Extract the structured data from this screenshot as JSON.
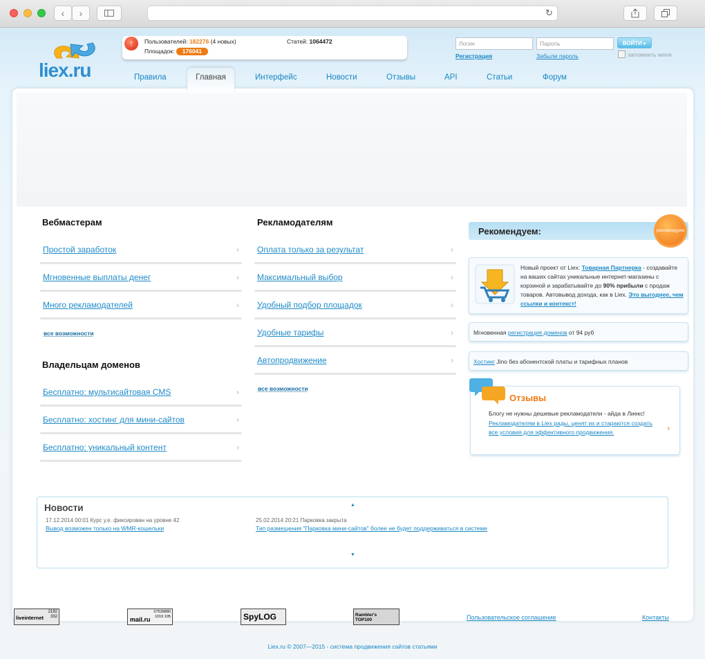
{
  "browser": {
    "back_icon": "chevron-left-icon",
    "forward_icon": "chevron-right-icon",
    "sidebar_icon": "sidebar-icon",
    "reload_icon": "reload-icon",
    "share_icon": "share-icon",
    "tabs_icon": "tabs-icon"
  },
  "header": {
    "logo_text": "liex.ru",
    "stats": {
      "users_label": "Пользователей:",
      "users_value": "182276",
      "users_new": "(4 новых)",
      "sites_label": "Площадок:",
      "sites_value": "176041",
      "articles_label": "Статей:",
      "articles_value": "1064472"
    },
    "login": {
      "login_placeholder": "Логин",
      "password_placeholder": "Пароль",
      "submit_label": "ВОЙТИ",
      "register_label": "Регистрация",
      "forgot_label": "Забыли пароль",
      "remember_label": "запомнить меня"
    }
  },
  "menu": {
    "items": [
      {
        "label": "Правила"
      },
      {
        "label": "Главная"
      },
      {
        "label": "Интерфейс"
      },
      {
        "label": "Новости"
      },
      {
        "label": "Отзывы"
      },
      {
        "label": "API"
      },
      {
        "label": "Статьи"
      },
      {
        "label": "Форум"
      }
    ]
  },
  "webmasters": {
    "title": "Вебмастерам",
    "items": [
      {
        "label": "Простой заработок"
      },
      {
        "label": "Мгновенные выплаты денег"
      },
      {
        "label": "Много рекламодателей"
      }
    ],
    "all_label": "все возможности"
  },
  "domain_owners": {
    "title": "Владельцам доменов",
    "items": [
      {
        "label": "Бесплатно: мультисайтовая CMS"
      },
      {
        "label": "Бесплатно: хостинг для мини-сайтов"
      },
      {
        "label": "Бесплатно: уникальный контент"
      }
    ]
  },
  "advertisers": {
    "title": "Рекламодателям",
    "items": [
      {
        "label": "Оплата только за результат"
      },
      {
        "label": "Максимальный выбор"
      },
      {
        "label": "Удобный подбор площадок"
      },
      {
        "label": "Удобные тарифы"
      },
      {
        "label": "Автопродвижение"
      }
    ],
    "all_label": "все возможности"
  },
  "recommend": {
    "title": "Рекомендуем:",
    "badge": "рекомендуем",
    "box1": {
      "text1": "Новый проект от Liex:",
      "link1": "Товарная Партнерка",
      "text2": "- создавайте на ваших сайтах уникальные интернет-магазины с корзиной и зарабатывайте до",
      "percent": "90% прибыли",
      "text3": "с продаж товаров. Автовывод дохода, как в Liex.",
      "link2": "Это выгоднее, чем ссылки и контекст!"
    },
    "box2": {
      "text1": "Мгновенная",
      "link": "регистрация доменов",
      "text2": "от 94 руб"
    },
    "box3": {
      "link": "Хостинг",
      "text": "Jino без абонентской платы и тарифных планов"
    },
    "reviews": {
      "title": "Отзывы",
      "line1": "Блогу не нужны дешевые рекламодатели - айда в Лиекс!",
      "line2": "Рекламодателям в Liex рады, ценят их и стараются создать все условия для эффективного продвижения."
    }
  },
  "news": {
    "title": "Новости",
    "items": [
      {
        "date": "17.12.2014 00:01 Курс у.е. фиксирован на уровне 42",
        "link": "Вывод возможен только на WMR-кошельки"
      },
      {
        "date": "25.02.2014 20:21 Парковка закрыта",
        "link": "Тип размещения \"Парковка мини-сайтов\" более не будет поддерживаться в системе"
      }
    ]
  },
  "footer": {
    "counters": [
      {
        "name": "liveinternet",
        "label": "liveinternet",
        "numbers": "2192 332"
      },
      {
        "name": "mail-ru",
        "label": "mail.ru",
        "numbers": "07539880 1019 105"
      },
      {
        "name": "spylog",
        "label": "SpyLOG"
      },
      {
        "name": "rambler",
        "label": "Rambler's TOP100"
      }
    ],
    "agreement_label": "Пользовательское соглашение",
    "contacts_label": "Контакты",
    "copyright": "Liex.ru © 2007—2015 - система продвижения сайтов статьями"
  }
}
